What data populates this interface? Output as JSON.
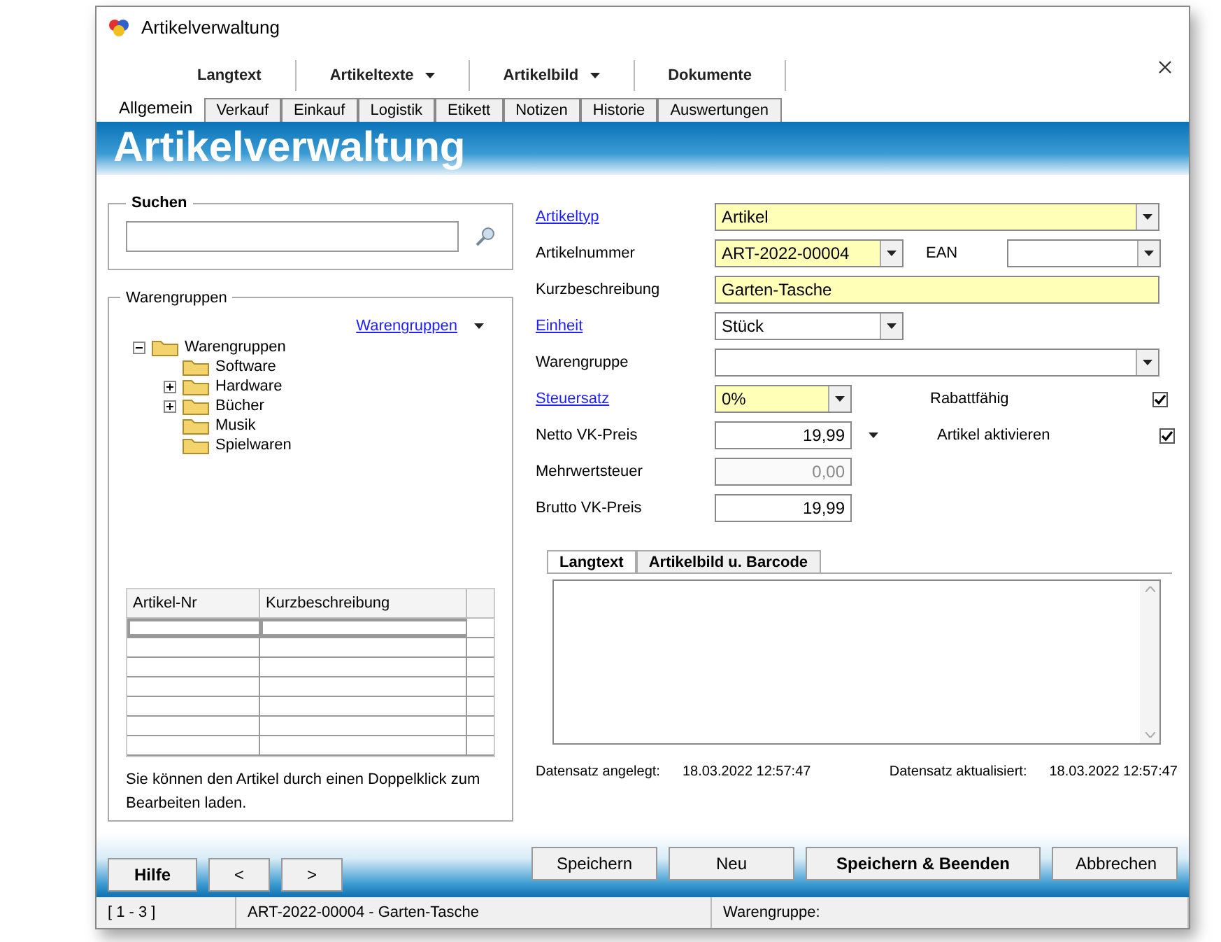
{
  "window": {
    "title": "Artikelverwaltung"
  },
  "toolbar": [
    {
      "label": "Langtext",
      "dropdown": false
    },
    {
      "label": "Artikeltexte",
      "dropdown": true
    },
    {
      "label": "Artikelbild",
      "dropdown": true
    },
    {
      "label": "Dokumente",
      "dropdown": false
    }
  ],
  "tabs": [
    {
      "label": "Allgemein",
      "selected": true
    },
    {
      "label": "Verkauf",
      "selected": false
    },
    {
      "label": "Einkauf",
      "selected": false
    },
    {
      "label": "Logistik",
      "selected": false
    },
    {
      "label": "Etikett",
      "selected": false
    },
    {
      "label": "Notizen",
      "selected": false
    },
    {
      "label": "Historie",
      "selected": false
    },
    {
      "label": "Auswertungen",
      "selected": false
    }
  ],
  "header": "Artikelverwaltung",
  "search": {
    "title": "Suchen"
  },
  "groups": {
    "title": "Warengruppen",
    "link": "Warengruppen",
    "tree": [
      {
        "label": "Warengruppen",
        "expanded": true,
        "children": [
          {
            "label": "Software",
            "expandable": false
          },
          {
            "label": "Hardware",
            "expandable": true
          },
          {
            "label": "Bücher",
            "expandable": true
          },
          {
            "label": "Musik",
            "expandable": false
          },
          {
            "label": "Spielwaren",
            "expandable": false
          }
        ]
      }
    ]
  },
  "table": {
    "columns": [
      "Artikel-Nr",
      "Kurzbeschreibung"
    ]
  },
  "hint": "Sie können den Artikel durch einen Doppelklick zum Bearbeiten laden.",
  "fields": [
    {
      "label": "Artikeltyp",
      "link": true,
      "kind": "combo",
      "value": "Artikel",
      "highlighted": true
    },
    {
      "label": "Artikelnummer",
      "link": false,
      "kind": "combo",
      "value": "ART-2022-00004",
      "highlighted": true
    },
    {
      "label": "Kurzbeschreibung",
      "link": false,
      "kind": "text",
      "value": "Garten-Tasche",
      "highlighted": true
    },
    {
      "label": "Einheit",
      "link": true,
      "kind": "combo",
      "value": "Stück",
      "highlighted": false
    },
    {
      "label": "Warengruppe",
      "link": false,
      "kind": "combo",
      "highlighted": false
    },
    {
      "label": "Steuersatz",
      "link": true,
      "kind": "combo",
      "value": "0%",
      "highlighted": true
    },
    {
      "label": "Netto VK-Preis",
      "link": false,
      "kind": "number",
      "value": "19,99",
      "highlighted": false,
      "disabled": false
    },
    {
      "label": "Mehrwertsteuer",
      "link": false,
      "kind": "number",
      "value": "0,00",
      "highlighted": false,
      "disabled": true
    },
    {
      "label": "Brutto VK-Preis",
      "link": false,
      "kind": "number",
      "value": "19,99",
      "highlighted": false,
      "disabled": false
    }
  ],
  "ean": {
    "label": "EAN"
  },
  "options": [
    {
      "label": "Rabattfähig",
      "checked": true
    },
    {
      "label": "Artikel aktivieren",
      "checked": true
    }
  ],
  "subtabs": [
    {
      "label": "Langtext",
      "selected": true
    },
    {
      "label": "Artikelbild u. Barcode",
      "selected": false
    }
  ],
  "created": {
    "label": "Datensatz angelegt:",
    "value": "18.03.2022 12:57:47"
  },
  "updated": {
    "label": "Datensatz aktualisiert:",
    "value": "18.03.2022 12:57:47"
  },
  "nav_buttons": [
    "Hilfe",
    "<",
    ">"
  ],
  "buttons": [
    {
      "label": "Speichern",
      "bold": false
    },
    {
      "label": "Neu",
      "bold": false
    },
    {
      "label": "Speichern & Beenden",
      "bold": true
    },
    {
      "label": "Abbrechen",
      "bold": false
    }
  ],
  "status_bar": [
    "[ 1 - 3 ]",
    "ART-2022-00004 - Garten-Tasche",
    "Warengruppe:"
  ]
}
